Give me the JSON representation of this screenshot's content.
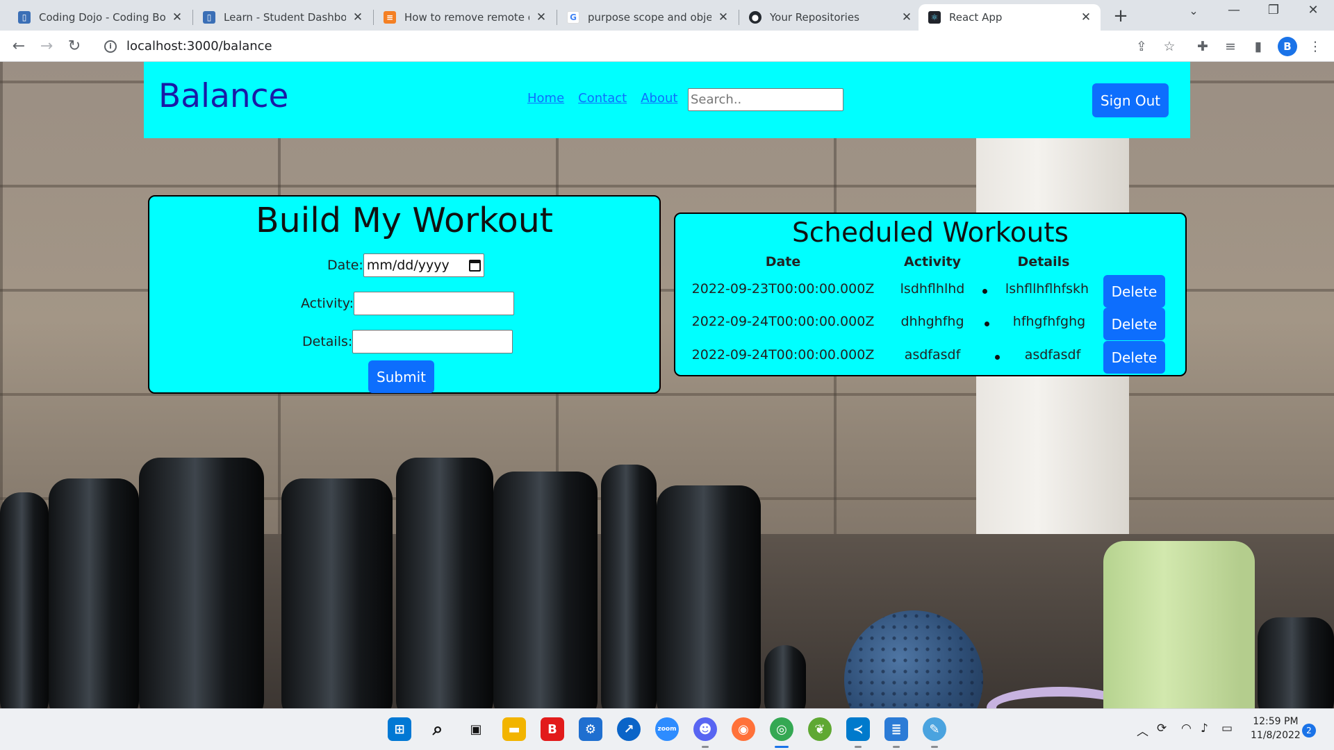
{
  "browser": {
    "tabs": [
      {
        "title": "Coding Dojo - Coding Boot",
        "icon": "codingdojo-icon",
        "color": "#3b6fb6",
        "glyph": "▯"
      },
      {
        "title": "Learn - Student Dashboard",
        "icon": "codingdojo-icon",
        "color": "#3b6fb6",
        "glyph": "▯"
      },
      {
        "title": "How to remove remote orig",
        "icon": "stackoverflow-icon",
        "color": "#f48024",
        "glyph": "≡"
      },
      {
        "title": "purpose scope and objectiv",
        "icon": "google-icon",
        "color": "#4285f4",
        "glyph": "G"
      },
      {
        "title": "Your Repositories",
        "icon": "github-icon",
        "color": "#24292f",
        "glyph": "●"
      },
      {
        "title": "React App",
        "icon": "react-icon",
        "color": "#20232a",
        "glyph": "⚛"
      }
    ],
    "url": "localhost:3000/balance",
    "profile_initial": "B"
  },
  "header": {
    "brand": "Balance",
    "links": [
      "Home",
      "Contact",
      "About"
    ],
    "search_placeholder": "Search..",
    "signout_label": "Sign Out"
  },
  "build_form": {
    "title": "Build My Workout",
    "date_label": "Date:",
    "date_placeholder": "mm/dd/yyyy",
    "activity_label": "Activity:",
    "activity_value": "",
    "details_label": "Details:",
    "details_value": "",
    "submit_label": "Submit"
  },
  "scheduled": {
    "title": "Scheduled Workouts",
    "columns": [
      "Date",
      "Activity",
      "Details"
    ],
    "rows": [
      {
        "date": "2022-09-23T00:00:00.000Z",
        "activity": "lsdhflhlhd",
        "details": "lshfllhflhfskh",
        "action": "Delete"
      },
      {
        "date": "2022-09-24T00:00:00.000Z",
        "activity": "dhhghfhg",
        "details": "hfhgfhfghg",
        "action": "Delete"
      },
      {
        "date": "2022-09-24T00:00:00.000Z",
        "activity": "asdfasdf",
        "details": "asdfasdf",
        "action": "Delete"
      }
    ]
  },
  "taskbar": {
    "apps": [
      {
        "name": "windows-start-icon",
        "color": "#0078d4",
        "glyph": "⊞"
      },
      {
        "name": "search-icon",
        "color": "#eef0f3",
        "glyph": "⌕"
      },
      {
        "name": "task-view-icon",
        "color": "#eef0f3",
        "glyph": "▣"
      },
      {
        "name": "file-explorer-icon",
        "color": "#f2b400",
        "glyph": "▬"
      },
      {
        "name": "bitdefender-icon",
        "color": "#e21b1b",
        "glyph": "B"
      },
      {
        "name": "control-panel-icon",
        "color": "#1f6fd0",
        "glyph": "⚙"
      },
      {
        "name": "app-blue-icon",
        "color": "#0a64c8",
        "glyph": "↗"
      },
      {
        "name": "zoom-icon",
        "color": "#2d8cff",
        "glyph": "zoom"
      },
      {
        "name": "discord-icon",
        "color": "#5865f2",
        "glyph": "☻"
      },
      {
        "name": "firefox-icon",
        "color": "#ff7139",
        "glyph": "◉"
      },
      {
        "name": "chrome-icon",
        "color": "#34a853",
        "glyph": "◎"
      },
      {
        "name": "springtools-icon",
        "color": "#5fa832",
        "glyph": "❦"
      },
      {
        "name": "vscode-icon",
        "color": "#007acc",
        "glyph": "≺"
      },
      {
        "name": "notepad-icon",
        "color": "#2b7bd6",
        "glyph": "≣"
      },
      {
        "name": "paint-icon",
        "color": "#4aa3df",
        "glyph": "✎"
      }
    ],
    "time": "12:59 PM",
    "date": "11/8/2022",
    "notifications": "2"
  }
}
